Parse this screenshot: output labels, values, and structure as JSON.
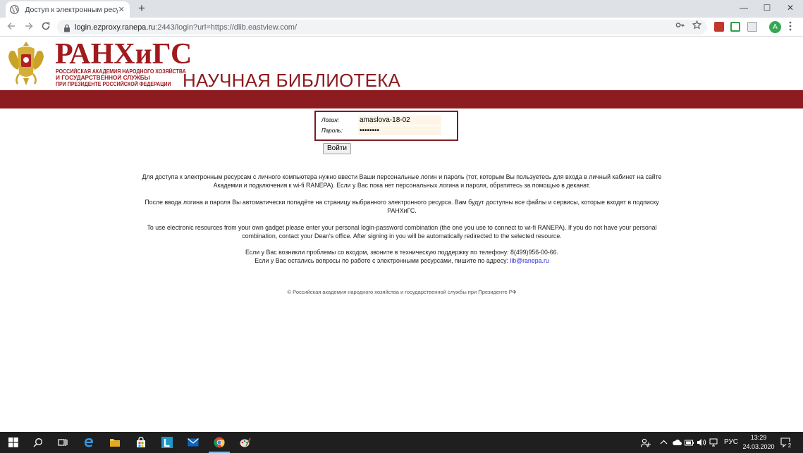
{
  "browser": {
    "tab_title": "Доступ к электронным ресурсам",
    "tab_close": "✕",
    "new_tab": "+",
    "url_host": "login.ezproxy.ranepa.ru",
    "url_rest": ":2443/login?url=https://dlib.eastview.com/",
    "profile_initial": "A",
    "controls": {
      "minimize": "—",
      "maximize": "☐",
      "close": "✕"
    }
  },
  "header": {
    "brand": "РАНХиГС",
    "brand_lines": [
      "РОССИЙСКАЯ АКАДЕМИЯ НАРОДНОГО ХОЗЯЙСТВА",
      "И  ГОСУДАРСТВЕННОЙ  СЛУЖБЫ",
      "ПРИ ПРЕЗИДЕНТЕ РОССИЙСКОЙ ФЕДЕРАЦИИ"
    ],
    "library_title": "НАУЧНАЯ БИБЛИОТЕКА"
  },
  "login": {
    "login_label": "Логин:",
    "login_value": "amaslova-18-02",
    "password_label": "Пароль:",
    "password_value": "••••••••",
    "submit_label": "Войти"
  },
  "info": {
    "p1": "Для доступа к электронным ресурсам с личного компьютера нужно ввести Ваши персональные логин и пароль (тот, которым Вы пользуетесь для входа в личный кабинет на сайте Академии и подключения к wi-fi RANEPA). Если у Вас пока нет персональных логина и пароля, обратитесь за помощью в деканат.",
    "p2": "После ввода логина и пароля Вы автоматически попадёте на страницу выбранного электронного ресурса. Вам будут доступны все файлы и сервисы, которые входят в подписку РАНХиГС.",
    "p3": "To use electronic resources from your own gadget please enter your personal login-password combination (the one you use to connect to wi-fi RANEPA). If you do not have your personal combination, contact your Dean's office. After signing in you will be automatically redirected to the selected resource.",
    "p4_line1": "Если у Вас возникли проблемы со входом, звоните в техническую поддержку по телефону: 8(499)956-00-66.",
    "p4_line2_prefix": "Если у Вас остались вопросы по работе с электронными ресурсами, пишите по адресу: ",
    "p4_email": "lib@ranepa.ru"
  },
  "footer": {
    "copyright": "© Российская академия народного хозяйства и государственной службы при Президенте РФ"
  },
  "taskbar": {
    "language": "РУС",
    "time": "13:29",
    "date": "24.03.2020",
    "notification_count": "2"
  },
  "colors": {
    "brand_red": "#a01a1e",
    "band_red": "#8c1c20",
    "link_blue": "#2b2bd6"
  }
}
